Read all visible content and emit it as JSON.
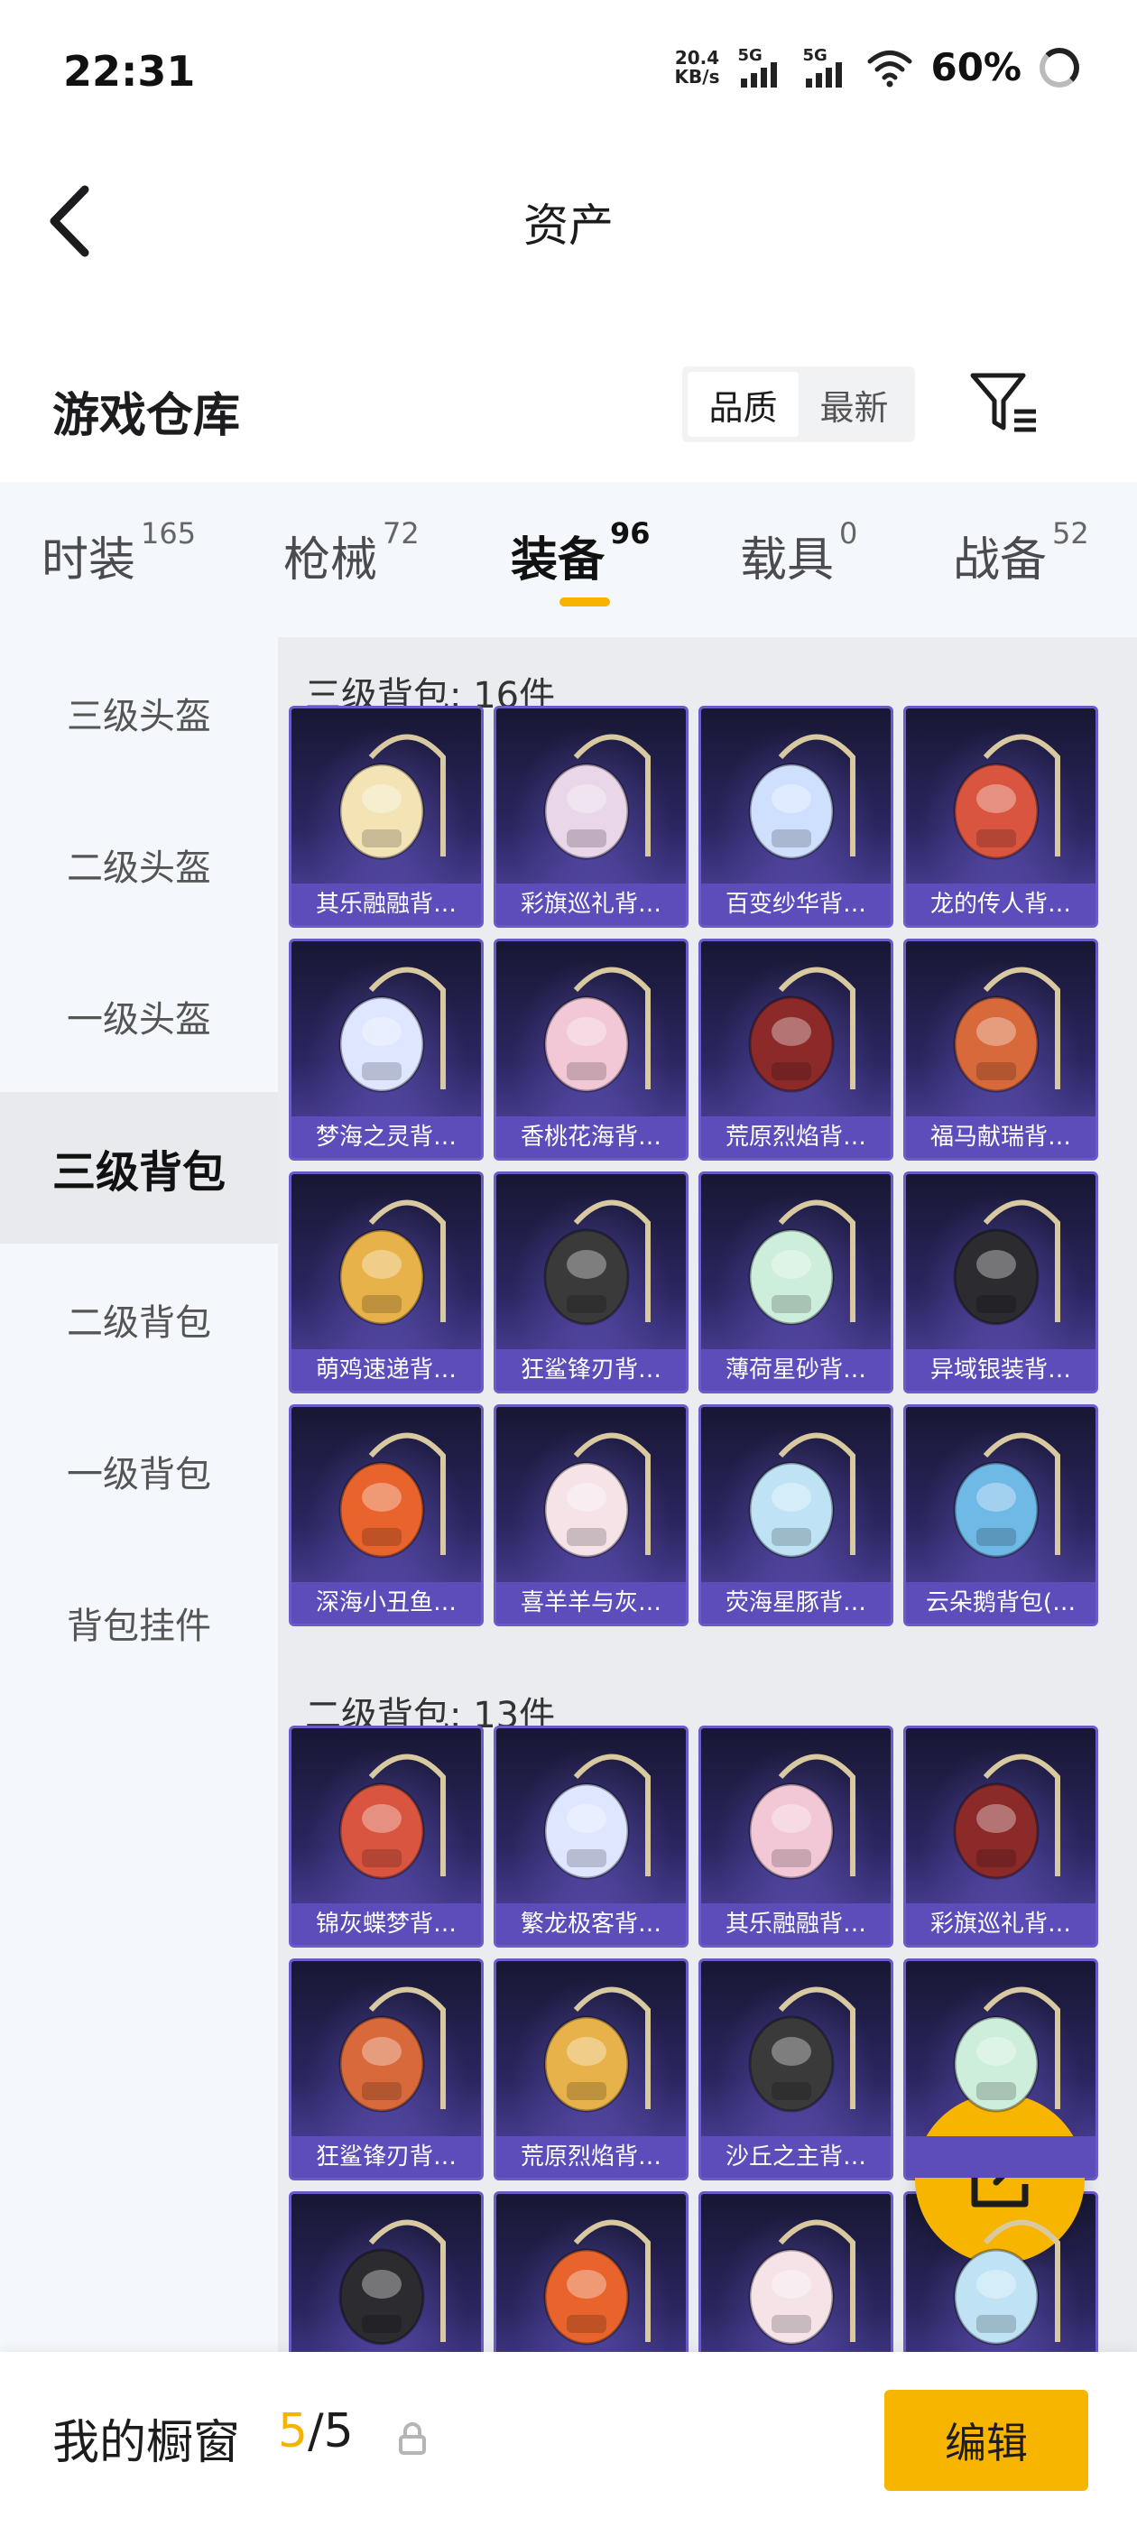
{
  "status_bar": {
    "time": "22:31",
    "net_speed_value": "20.4",
    "net_speed_unit": "KB/s",
    "sim1_label": "5G",
    "sim2_label": "5G",
    "battery": "60%"
  },
  "header": {
    "title": "资产"
  },
  "section": {
    "title": "游戏仓库",
    "sort_options": [
      "品质",
      "最新"
    ],
    "selected_sort": "品质"
  },
  "tabs": [
    {
      "label": "时装",
      "count": "165"
    },
    {
      "label": "枪械",
      "count": "72"
    },
    {
      "label": "装备",
      "count": "96"
    },
    {
      "label": "载具",
      "count": "0"
    },
    {
      "label": "战备",
      "count": "52"
    }
  ],
  "active_tab": "装备",
  "sidebar": {
    "items": [
      "三级头盔",
      "二级头盔",
      "一级头盔",
      "三级背包",
      "二级背包",
      "一级背包",
      "背包挂件"
    ],
    "active": "三级背包"
  },
  "groups": [
    {
      "title": "三级背包: 16件",
      "items": [
        "其乐融融背…",
        "彩旗巡礼背…",
        "百变纱华背…",
        "龙的传人背…",
        "梦海之灵背…",
        "香桃花海背…",
        "荒原烈焰背…",
        "福马献瑞背…",
        "萌鸡速递背…",
        "狂鲨锋刃背…",
        "薄荷星砂背…",
        "异域银装背…",
        "深海小丑鱼…",
        "喜羊羊与灰…",
        "荧海星豚背…",
        "云朵鹅背包(…"
      ]
    },
    {
      "title": "二级背包: 13件",
      "items": [
        "锦灰蝶梦背…",
        "繁龙极客背…",
        "其乐融融背…",
        "彩旗巡礼背…",
        "狂鲨锋刃背…",
        "荒原烈焰背…",
        "沙丘之主背…",
        "",
        "",
        "",
        "",
        ""
      ]
    }
  ],
  "bottom_bar": {
    "label": "我的橱窗",
    "current": "5",
    "separator": "/",
    "total": "5",
    "edit_label": "编辑"
  },
  "icons": {
    "back": "chevron-left-icon",
    "filter": "filter-icon",
    "fab": "share-external-icon",
    "lock": "lock-icon"
  },
  "colors": {
    "accent": "#f7b500",
    "card_label": "#5c4dbb",
    "card_bg": "#2b2660",
    "sidebar_bg": "#f4f7fb"
  }
}
